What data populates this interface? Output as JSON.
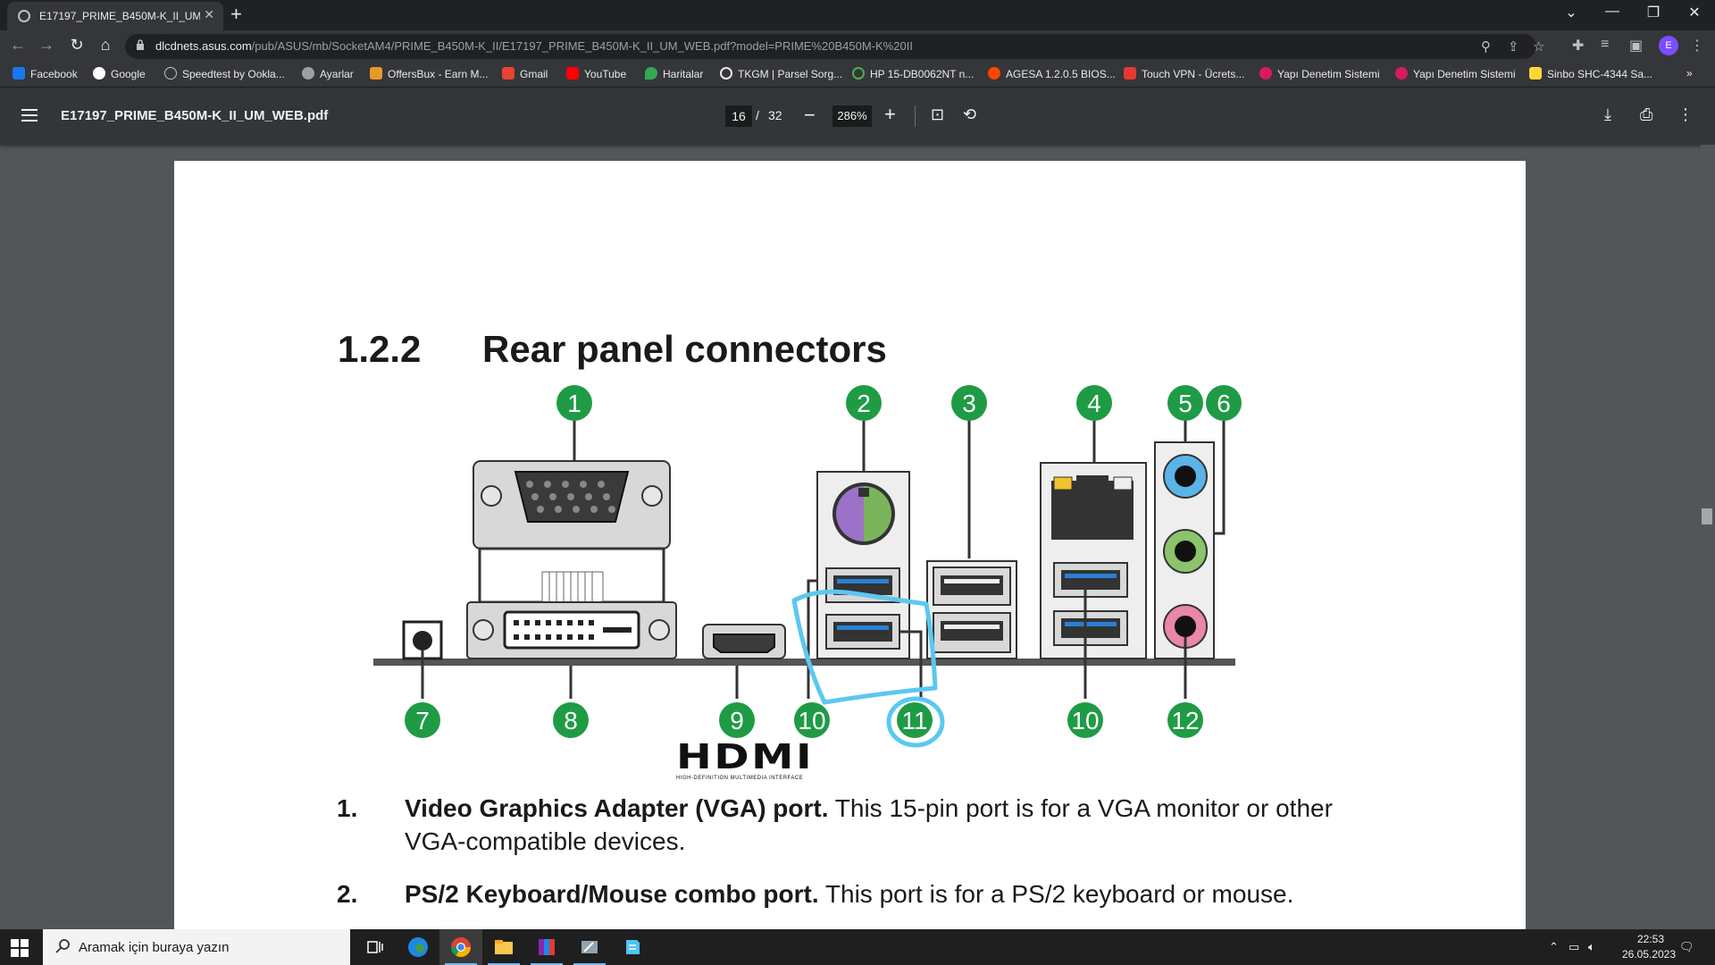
{
  "tab": {
    "title": "E17197_PRIME_B450M-K_II_UM_"
  },
  "window": {
    "minimize_icon": "minimize-icon",
    "restore_icon": "restore-icon",
    "close_icon": "close-icon"
  },
  "address": {
    "host": "dlcdnets.asus.com",
    "path": "/pub/ASUS/mb/SocketAM4/PRIME_B450M-K_II/E17197_PRIME_B450M-K_II_UM_WEB.pdf?model=PRIME%20B450M-K%20II"
  },
  "bookmarks": [
    {
      "label": "Facebook",
      "color": "#1877f2"
    },
    {
      "label": "Google",
      "color": "#ffffff"
    },
    {
      "label": "Speedtest by Ookla...",
      "color": "#141526"
    },
    {
      "label": "Ayarlar",
      "color": "#9aa0a6"
    },
    {
      "label": "OffersBux - Earn M...",
      "color": "#e59a2b"
    },
    {
      "label": "Gmail",
      "color": "#ea4335"
    },
    {
      "label": "YouTube",
      "color": "#ff0000"
    },
    {
      "label": "Haritalar",
      "color": "#34a853"
    },
    {
      "label": "TKGM | Parsel Sorg...",
      "color": "#202124"
    },
    {
      "label": "HP 15-DB0062NT n...",
      "color": "#2e7d32"
    },
    {
      "label": "AGESA 1.2.0.5 BIOS...",
      "color": "#ff4500"
    },
    {
      "label": "Touch VPN - Ücrets...",
      "color": "#e53935"
    },
    {
      "label": "Yapı Denetim Sistemi",
      "color": "#d81b60"
    },
    {
      "label": "Yapı Denetim Sistemi",
      "color": "#d81b60"
    },
    {
      "label": "Sinbo SHC-4344 Sa...",
      "color": "#fdd835"
    }
  ],
  "pdf": {
    "filename": "E17197_PRIME_B450M-K_II_UM_WEB.pdf",
    "page_current": "16",
    "page_separator": "/",
    "page_total": "32",
    "zoom": "286%",
    "zoom_out": "−",
    "zoom_in": "+"
  },
  "doc": {
    "section_number": "1.2.2",
    "section_title": "Rear panel connectors",
    "callouts": [
      "1",
      "2",
      "3",
      "4",
      "5",
      "6",
      "7",
      "8",
      "9",
      "10",
      "11",
      "10",
      "12"
    ],
    "hdmi_logo": "HDMI",
    "hdmi_tm": "™",
    "hdmi_tagline": "HIGH-DEFINITION MULTIMEDIA INTERFACE",
    "items": [
      {
        "num": "1.",
        "bold": "Video Graphics Adapter (VGA) port.",
        "text": " This 15-pin port is for a VGA monitor or other VGA-compatible devices."
      },
      {
        "num": "2.",
        "bold": "PS/2 Keyboard/Mouse combo port.",
        "text": " This port is for a PS/2 keyboard or mouse."
      }
    ],
    "annotation_color": "#5bc8f0"
  },
  "taskbar": {
    "search_placeholder": "Aramak için buraya yazın",
    "time": "22:53",
    "date": "26.05.2023"
  }
}
